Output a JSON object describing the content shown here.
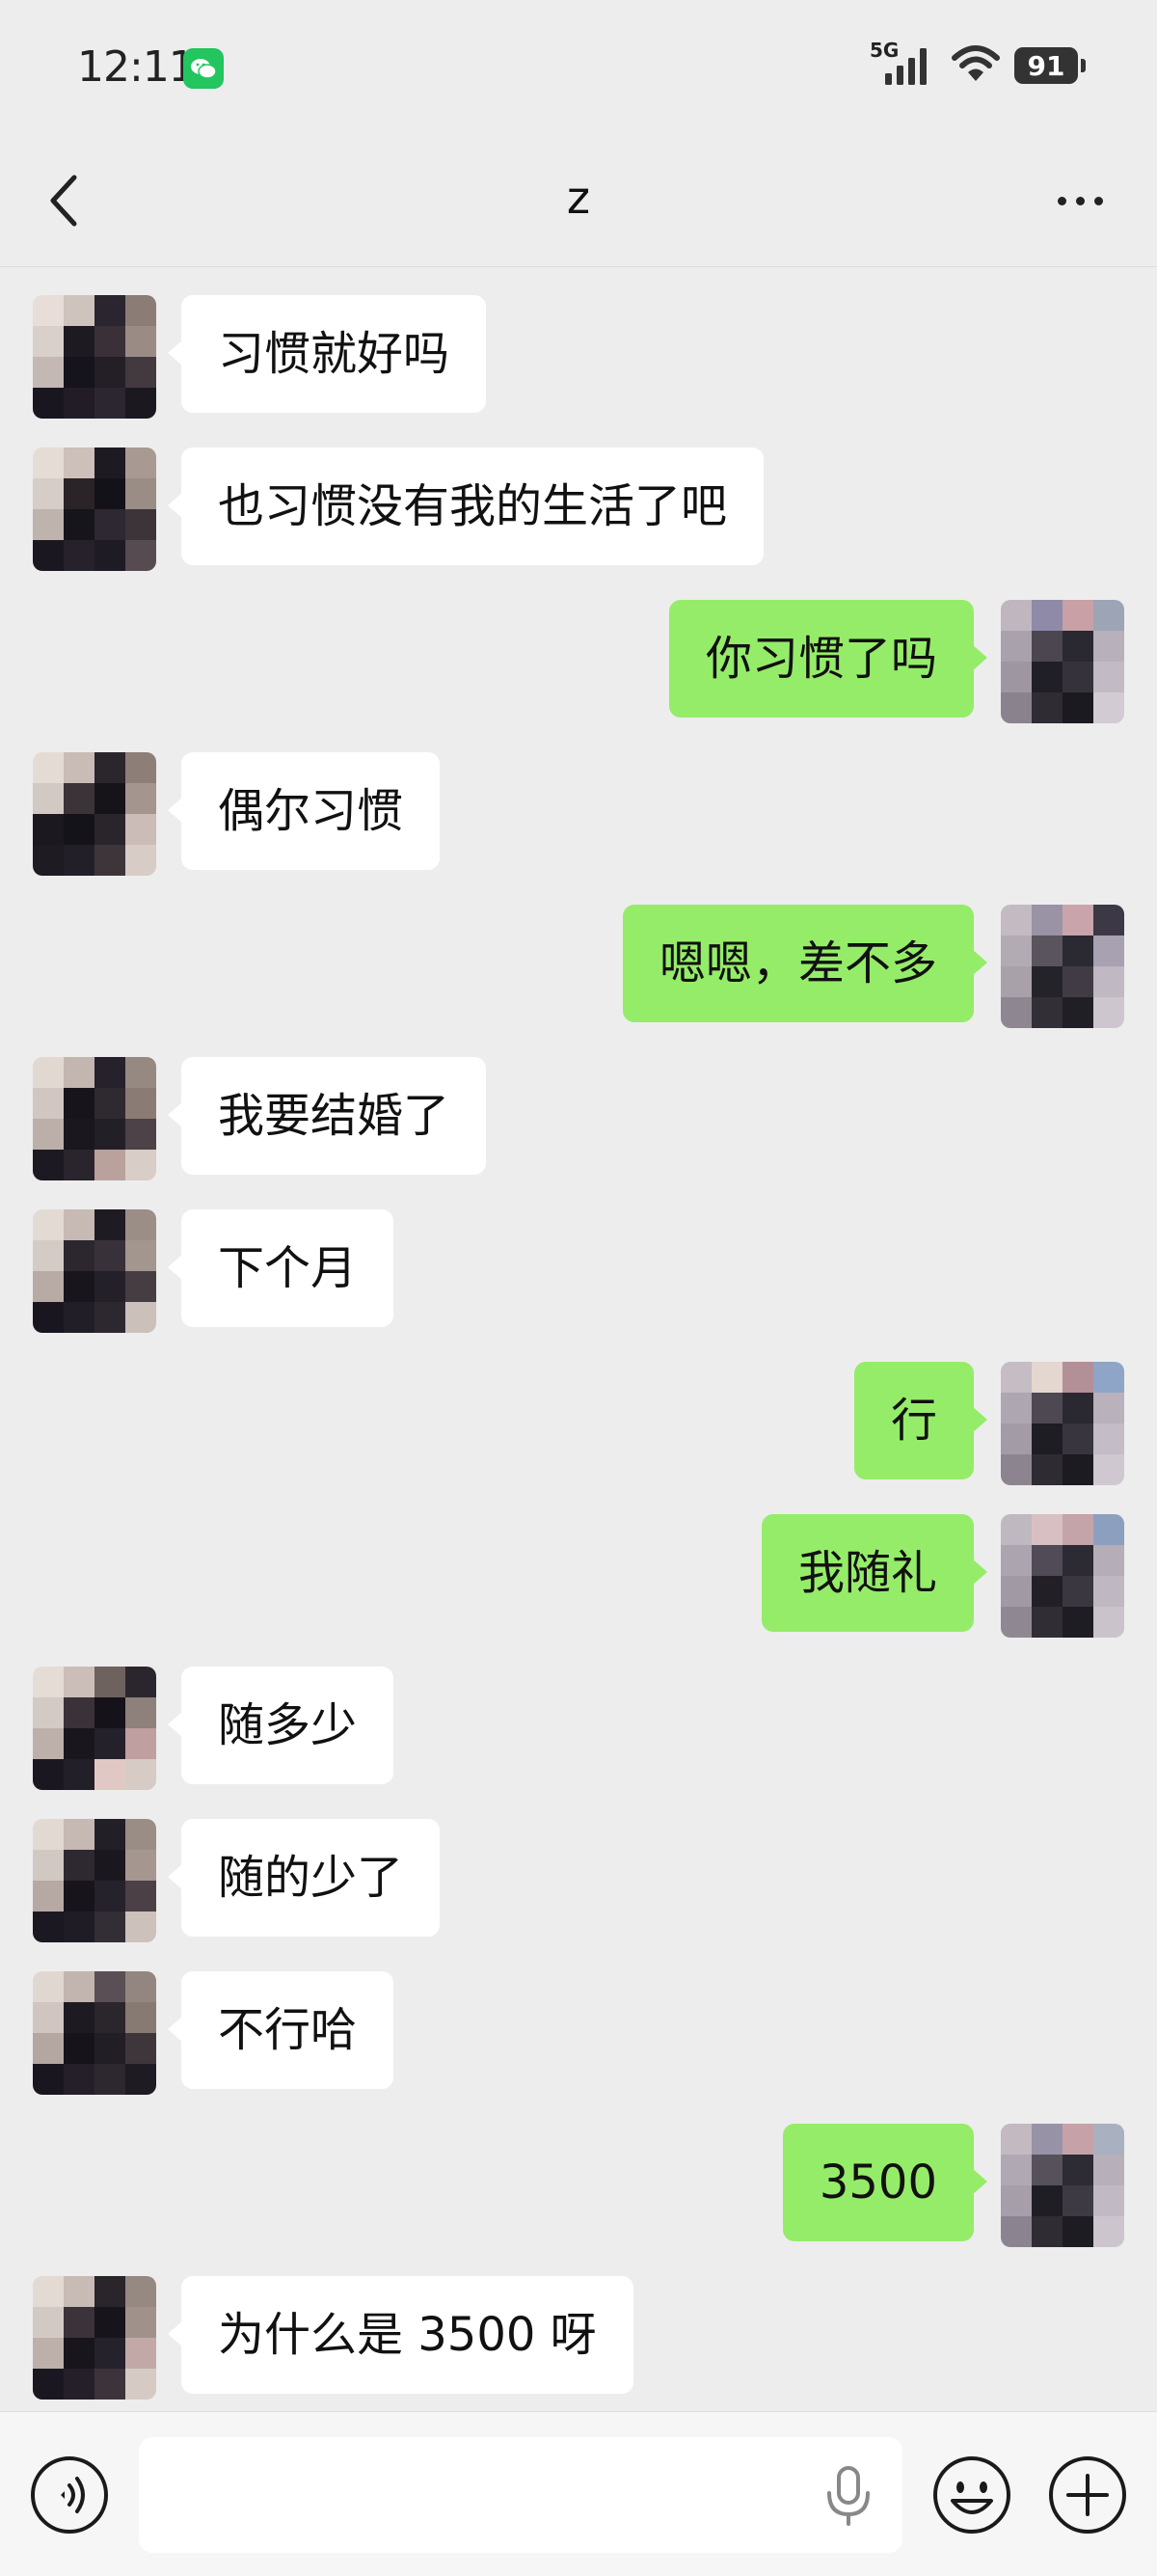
{
  "status_bar": {
    "time": "12:11",
    "network": "5G",
    "battery": "91"
  },
  "header": {
    "title": "z"
  },
  "messages": [
    {
      "side": "in",
      "text": "习惯就好吗"
    },
    {
      "side": "in",
      "text": "也习惯没有我的生活了吧"
    },
    {
      "side": "out",
      "text": "你习惯了吗"
    },
    {
      "side": "in",
      "text": "偶尔习惯"
    },
    {
      "side": "out",
      "text": "嗯嗯，差不多"
    },
    {
      "side": "in",
      "text": "我要结婚了"
    },
    {
      "side": "in",
      "text": "下个月"
    },
    {
      "side": "out",
      "text": "行"
    },
    {
      "side": "out",
      "text": "我随礼"
    },
    {
      "side": "in",
      "text": "随多少"
    },
    {
      "side": "in",
      "text": "随的少了"
    },
    {
      "side": "in",
      "text": "不行哈"
    },
    {
      "side": "out",
      "text": "3500"
    },
    {
      "side": "in",
      "text": "为什么是 3500 呀"
    }
  ],
  "input": {
    "value": ""
  },
  "colors": {
    "background": "#ededed",
    "outgoing_bubble": "#95ec69",
    "incoming_bubble": "#ffffff",
    "wechat_green": "#22c55e"
  },
  "icons": {
    "back": "chevron-left-icon",
    "more": "more-dots-icon",
    "voice": "voice-icon",
    "mic": "mic-icon",
    "emoji": "emoji-icon",
    "plus": "plus-icon"
  }
}
